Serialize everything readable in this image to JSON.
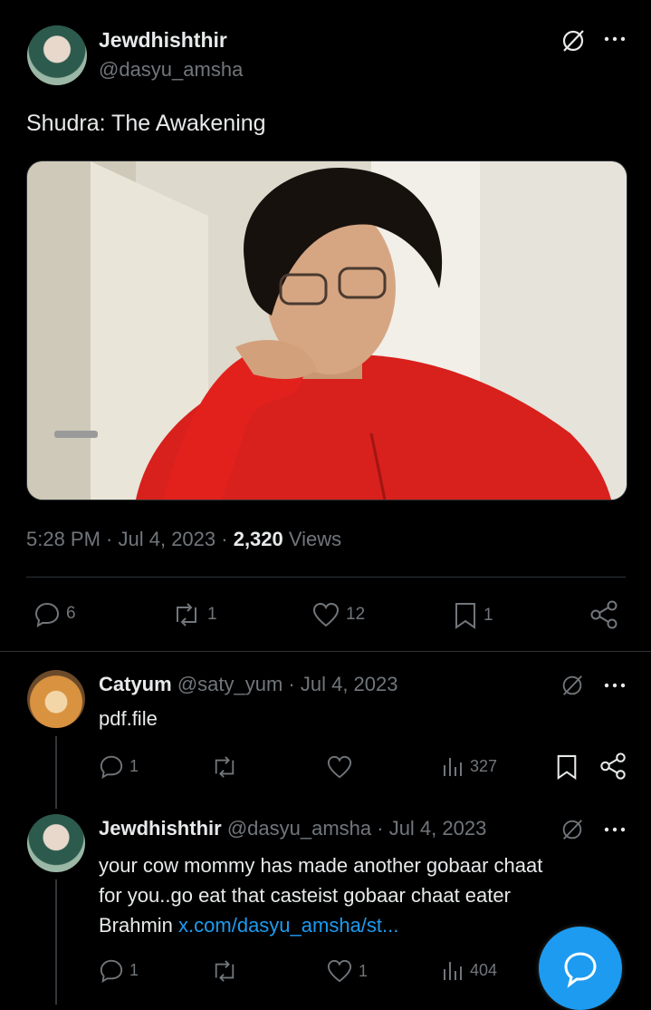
{
  "main_tweet": {
    "author_name": "Jewdhishthir",
    "author_handle": "@dasyu_amsha",
    "text": "Shudra: The Awakening",
    "time": "5:28 PM",
    "date": "Jul 4, 2023",
    "views_count": "2,320",
    "views_label": "Views",
    "replies": "6",
    "reposts": "1",
    "likes": "12",
    "bookmarks": "1"
  },
  "replies": [
    {
      "author_name": "Catyum",
      "author_handle": "@saty_yum",
      "date": "· Jul 4, 2023",
      "text": "pdf.file",
      "replies": "1",
      "views": "327"
    },
    {
      "author_name": "Jewdhishthir",
      "author_handle": "@dasyu_amsha",
      "date": "· Jul 4, 2023",
      "text_line1": "your cow mommy has made another gobaar chaat",
      "text_line2": "for you..go eat that casteist gobaar chaat eater",
      "text_line3": "Brahmin",
      "link": "x.com/dasyu_amsha/st...",
      "replies": "1",
      "likes": "1",
      "views": "404"
    }
  ],
  "colors": {
    "background": "#000000",
    "text": "#e7e9ea",
    "muted": "#71767b",
    "accent": "#1d9bf0",
    "link": "#1d9bf0"
  }
}
